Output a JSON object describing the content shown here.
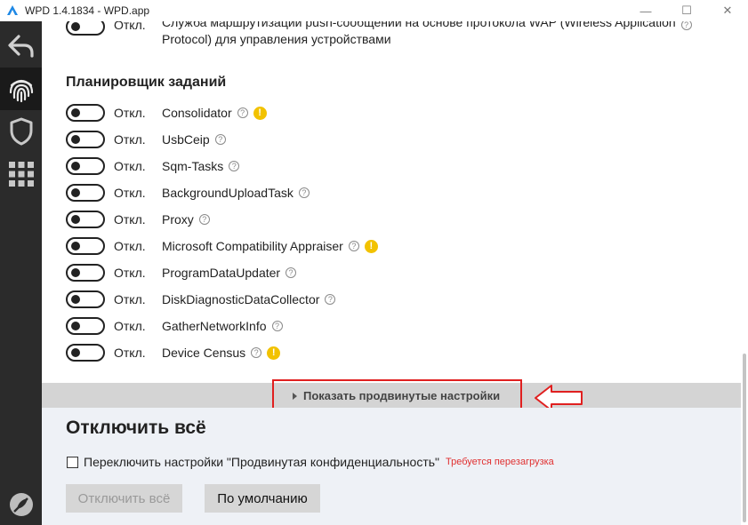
{
  "window": {
    "title": "WPD 1.4.1834 - WPD.app",
    "minimize": "—",
    "maximize": "☐",
    "close": "✕"
  },
  "sidebar": {
    "items": [
      {
        "icon": "back-arrow-icon",
        "active": false
      },
      {
        "icon": "fingerprint-icon",
        "active": true
      },
      {
        "icon": "shield-icon",
        "active": false
      },
      {
        "icon": "apps-grid-icon",
        "active": false
      },
      {
        "icon": "feather-icon",
        "active": false
      }
    ]
  },
  "top_item": {
    "state": "Откл.",
    "label_line1": "Служба маршрутизации push-сообщений на основе протокола WAP (Wireless Application",
    "label_line2": "Protocol) для управления устройствами"
  },
  "section": {
    "title": "Планировщик заданий",
    "help_glyph": "?",
    "warn_glyph": "!",
    "items": [
      {
        "state": "Откл.",
        "label": "Consolidator",
        "warning": true
      },
      {
        "state": "Откл.",
        "label": "UsbCeip",
        "warning": false
      },
      {
        "state": "Откл.",
        "label": "Sqm-Tasks",
        "warning": false
      },
      {
        "state": "Откл.",
        "label": "BackgroundUploadTask",
        "warning": false
      },
      {
        "state": "Откл.",
        "label": "Proxy",
        "warning": false
      },
      {
        "state": "Откл.",
        "label": "Microsoft Compatibility Appraiser",
        "warning": true
      },
      {
        "state": "Откл.",
        "label": "ProgramDataUpdater",
        "warning": false
      },
      {
        "state": "Откл.",
        "label": "DiskDiagnosticDataCollector",
        "warning": false
      },
      {
        "state": "Откл.",
        "label": "GatherNetworkInfo",
        "warning": false
      },
      {
        "state": "Откл.",
        "label": "Device Census",
        "warning": true
      }
    ]
  },
  "advanced": {
    "link_label": "Показать продвинутые настройки"
  },
  "bottom": {
    "title": "Отключить всё",
    "checkbox_label": "Переключить настройки \"Продвинутая конфиденциальность\"",
    "restart_note": "Требуется перезагрузка",
    "disable_all_button": "Отключить всё",
    "default_button": "По умолчанию"
  },
  "colors": {
    "sidebar_bg": "#2b2b2b",
    "highlight": "#e02020",
    "warning": "#f2c200",
    "restart_text": "#e03030"
  }
}
